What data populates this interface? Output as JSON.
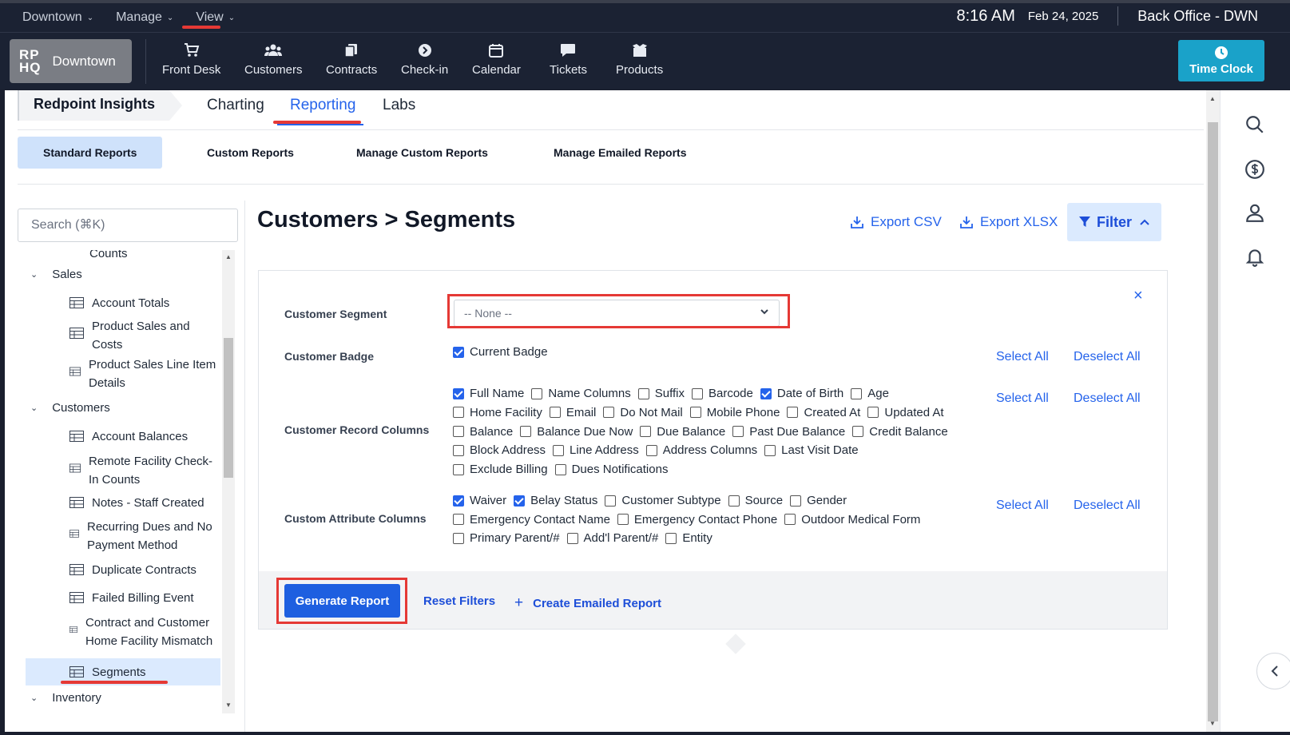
{
  "menubar": {
    "menus": [
      "Downtown",
      "Manage",
      "View"
    ],
    "time": "8:16 AM",
    "date": "Feb 24, 2025",
    "office": "Back Office - DWN"
  },
  "navbar": {
    "logo_mark_line1": "RP",
    "logo_mark_line2": "HQ",
    "logo_name": "Downtown",
    "items": [
      {
        "label": "Front Desk",
        "icon": "cart-icon"
      },
      {
        "label": "Customers",
        "icon": "users-icon"
      },
      {
        "label": "Contracts",
        "icon": "contracts-icon"
      },
      {
        "label": "Check-in",
        "icon": "arrow-circle-icon"
      },
      {
        "label": "Calendar",
        "icon": "calendar-icon"
      },
      {
        "label": "Tickets",
        "icon": "chat-icon"
      },
      {
        "label": "Products",
        "icon": "box-icon"
      }
    ],
    "time_clock_label": "Time Clock"
  },
  "insights": {
    "title": "Redpoint Insights",
    "tabs": [
      "Charting",
      "Reporting",
      "Labs"
    ],
    "active_tab": "Reporting"
  },
  "subtabs": {
    "items": [
      "Standard Reports",
      "Custom Reports",
      "Manage Custom Reports",
      "Manage Emailed Reports"
    ],
    "active": "Standard Reports"
  },
  "sidebar": {
    "search_placeholder": "Search (⌘K)",
    "partial_item": "Counts",
    "groups": [
      {
        "label": "Sales",
        "items": [
          "Account Totals",
          "Product Sales and Costs",
          "Product Sales Line Item Details"
        ]
      },
      {
        "label": "Customers",
        "items": [
          "Account Balances",
          "Remote Facility Check-In Counts",
          "Notes - Staff Created",
          "Recurring Dues and No Payment Method",
          "Duplicate Contracts",
          "Failed Billing Event",
          "Contract and Customer Home Facility Mismatch",
          "Segments"
        ]
      },
      {
        "label": "Inventory",
        "items": []
      }
    ],
    "selected": "Segments"
  },
  "content": {
    "title": "Customers > Segments",
    "export_csv": "Export CSV",
    "export_xlsx": "Export XLSX",
    "filter_label": "Filter"
  },
  "filters": {
    "segment_label": "Customer Segment",
    "segment_value": "-- None --",
    "badge_label": "Customer Badge",
    "badge_options": [
      {
        "label": "Current Badge",
        "checked": true
      }
    ],
    "record_label": "Customer Record Columns",
    "record_rows": [
      [
        {
          "label": "Full Name",
          "checked": true
        },
        {
          "label": "Name Columns",
          "checked": false
        },
        {
          "label": "Suffix",
          "checked": false
        },
        {
          "label": "Barcode",
          "checked": false
        },
        {
          "label": "Date of Birth",
          "checked": true
        },
        {
          "label": "Age",
          "checked": false
        }
      ],
      [
        {
          "label": "Home Facility",
          "checked": false
        },
        {
          "label": "Email",
          "checked": false
        },
        {
          "label": "Do Not Mail",
          "checked": false
        },
        {
          "label": "Mobile Phone",
          "checked": false
        },
        {
          "label": "Created At",
          "checked": false
        },
        {
          "label": "Updated At",
          "checked": false
        }
      ],
      [
        {
          "label": "Balance",
          "checked": false
        },
        {
          "label": "Balance Due Now",
          "checked": false
        },
        {
          "label": "Due Balance",
          "checked": false
        },
        {
          "label": "Past Due Balance",
          "checked": false
        },
        {
          "label": "Credit Balance",
          "checked": false
        }
      ],
      [
        {
          "label": "Block Address",
          "checked": false
        },
        {
          "label": "Line Address",
          "checked": false
        },
        {
          "label": "Address Columns",
          "checked": false
        },
        {
          "label": "Last Visit Date",
          "checked": false
        }
      ],
      [
        {
          "label": "Exclude Billing",
          "checked": false
        },
        {
          "label": "Dues Notifications",
          "checked": false
        }
      ]
    ],
    "attribute_label": "Custom Attribute Columns",
    "attribute_rows": [
      [
        {
          "label": "Waiver",
          "checked": true
        },
        {
          "label": "Belay Status",
          "checked": true
        },
        {
          "label": "Customer Subtype",
          "checked": false
        },
        {
          "label": "Source",
          "checked": false
        },
        {
          "label": "Gender",
          "checked": false
        }
      ],
      [
        {
          "label": "Emergency Contact Name",
          "checked": false
        },
        {
          "label": "Emergency Contact Phone",
          "checked": false
        },
        {
          "label": "Outdoor Medical Form",
          "checked": false
        }
      ],
      [
        {
          "label": "Primary Parent/#",
          "checked": false
        },
        {
          "label": "Add'l Parent/#",
          "checked": false
        },
        {
          "label": "Entity",
          "checked": false
        }
      ]
    ],
    "select_all": "Select All",
    "deselect_all": "Deselect All",
    "close_symbol": "×"
  },
  "footer": {
    "generate": "Generate Report",
    "reset": "Reset Filters",
    "create_emailed": "Create Emailed Report",
    "plus": "+"
  },
  "colors": {
    "accent": "#2563eb",
    "nav_bg": "#1b2233",
    "time_clock": "#1aa2c9",
    "highlight": "#e53935"
  }
}
